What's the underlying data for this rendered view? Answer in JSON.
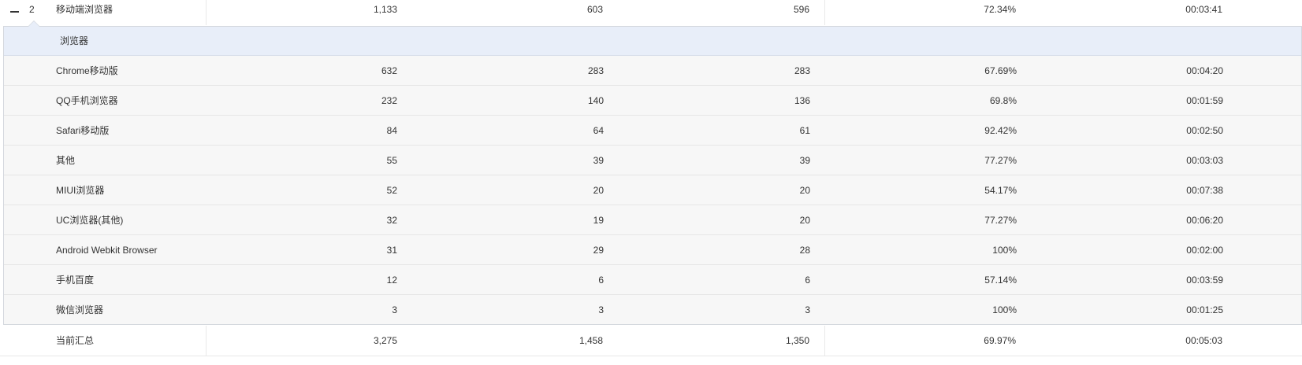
{
  "parent_row": {
    "index": "2",
    "name": "移动端浏览器",
    "v1": "1,133",
    "v2": "603",
    "v3": "596",
    "rate": "72.34%",
    "time": "00:03:41"
  },
  "panel": {
    "header": "浏览器",
    "rows": [
      {
        "name": "Chrome移动版",
        "v1": "632",
        "v2": "283",
        "v3": "283",
        "rate": "67.69%",
        "time": "00:04:20"
      },
      {
        "name": "QQ手机浏览器",
        "v1": "232",
        "v2": "140",
        "v3": "136",
        "rate": "69.8%",
        "time": "00:01:59"
      },
      {
        "name": "Safari移动版",
        "v1": "84",
        "v2": "64",
        "v3": "61",
        "rate": "92.42%",
        "time": "00:02:50"
      },
      {
        "name": "其他",
        "v1": "55",
        "v2": "39",
        "v3": "39",
        "rate": "77.27%",
        "time": "00:03:03"
      },
      {
        "name": "MIUI浏览器",
        "v1": "52",
        "v2": "20",
        "v3": "20",
        "rate": "54.17%",
        "time": "00:07:38"
      },
      {
        "name": "UC浏览器(其他)",
        "v1": "32",
        "v2": "19",
        "v3": "20",
        "rate": "77.27%",
        "time": "00:06:20"
      },
      {
        "name": "Android Webkit Browser",
        "v1": "31",
        "v2": "29",
        "v3": "28",
        "rate": "100%",
        "time": "00:02:00"
      },
      {
        "name": "手机百度",
        "v1": "12",
        "v2": "6",
        "v3": "6",
        "rate": "57.14%",
        "time": "00:03:59"
      },
      {
        "name": "微信浏览器",
        "v1": "3",
        "v2": "3",
        "v3": "3",
        "rate": "100%",
        "time": "00:01:25"
      }
    ]
  },
  "total_row": {
    "name": "当前汇总",
    "v1": "3,275",
    "v2": "1,458",
    "v3": "1,350",
    "rate": "69.97%",
    "time": "00:05:03"
  }
}
